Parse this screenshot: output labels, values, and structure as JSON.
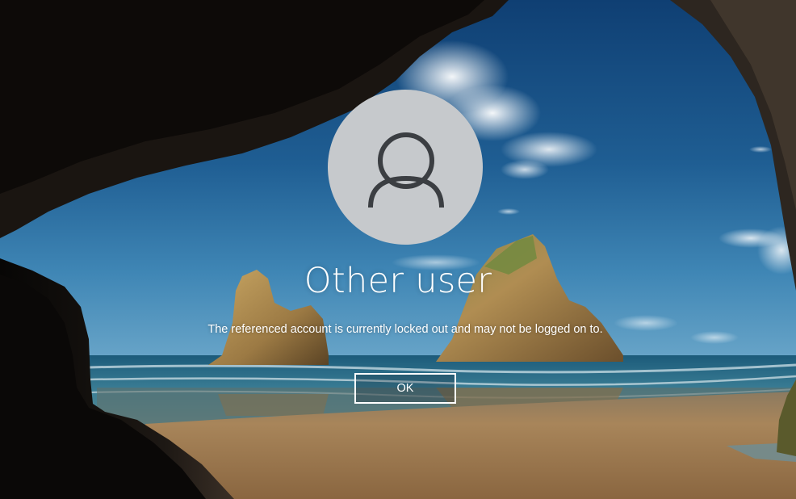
{
  "window": {
    "background_name": "cave-beach-wallpaper"
  },
  "user": {
    "name": "Other user",
    "avatar_icon": "user-icon"
  },
  "message": {
    "text": "The referenced account is currently locked out and may not be logged on to."
  },
  "actions": {
    "ok_label": "OK"
  },
  "colors": {
    "avatar_background": "#c6c9cc",
    "avatar_glyph": "#3b3e42",
    "text": "#ffffff",
    "sky_top": "#1a4f82",
    "sea": "#2b6f8e",
    "sand": "#b08b5e"
  }
}
